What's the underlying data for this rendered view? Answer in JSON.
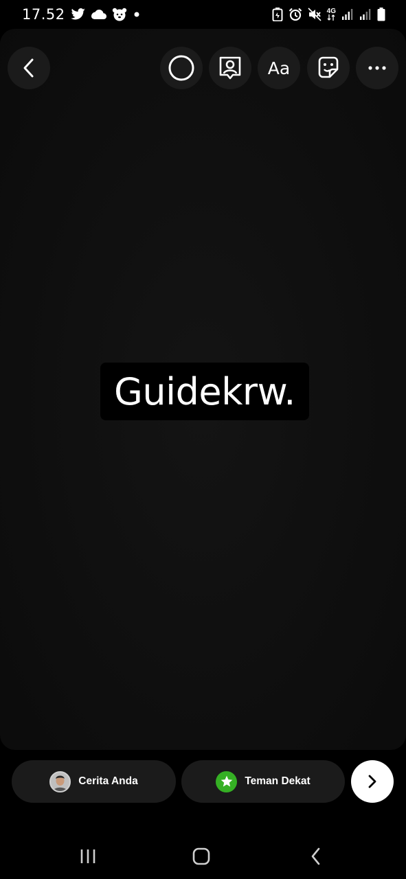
{
  "status_bar": {
    "time": "17.52",
    "left_icons": [
      "twitter-icon",
      "cloud-icon",
      "bear-icon",
      "dot-icon"
    ],
    "right_icons": [
      "battery-saver-icon",
      "alarm-icon",
      "mute-icon",
      "4g-icon",
      "signal-icon",
      "signal-icon",
      "battery-icon"
    ],
    "network_label": "4G"
  },
  "toolbar": {
    "buttons": [
      {
        "name": "back",
        "icon": "chevron-left-icon"
      },
      {
        "name": "circle",
        "icon": "circle-icon"
      },
      {
        "name": "portrait",
        "icon": "portrait-icon"
      },
      {
        "name": "text",
        "icon": "text-icon",
        "label": "Aa"
      },
      {
        "name": "sticker",
        "icon": "sticker-icon"
      },
      {
        "name": "more",
        "icon": "more-icon"
      }
    ]
  },
  "canvas": {
    "text": "Guidekrw."
  },
  "share_bar": {
    "your_story_label": "Cerita Anda",
    "close_friends_label": "Teman Dekat",
    "close_friends_color": "#35b024"
  },
  "nav": {
    "icons": [
      "recents-icon",
      "home-icon",
      "back-icon"
    ]
  }
}
